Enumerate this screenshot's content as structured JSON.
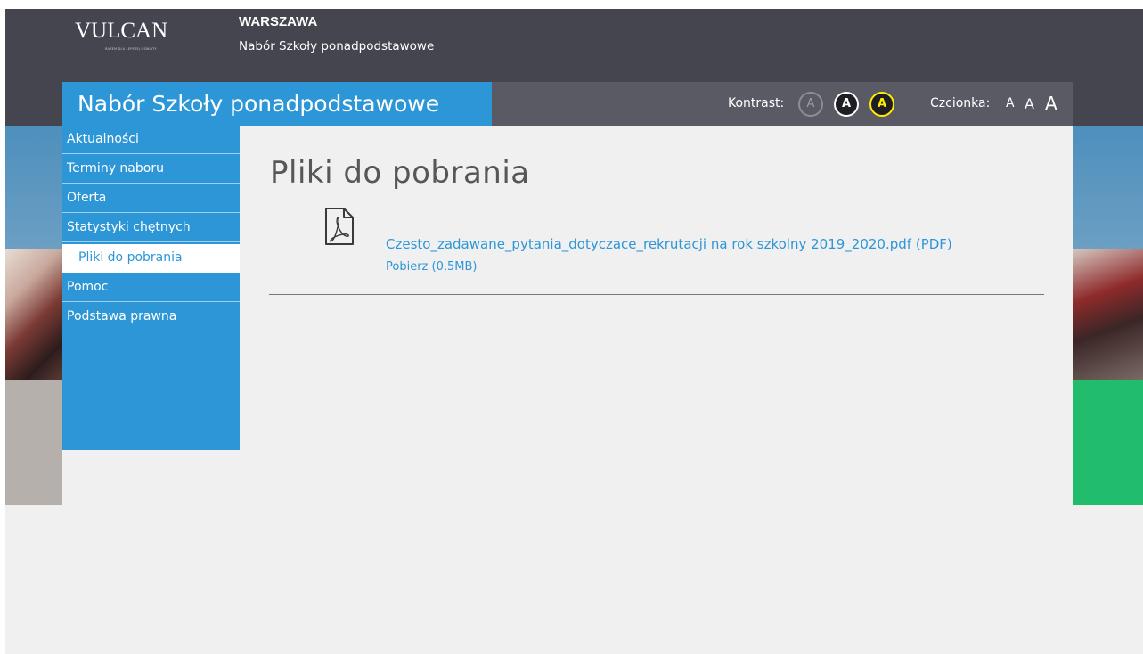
{
  "header": {
    "logo_text": "VULCAN",
    "logo_tagline": "RAZEM DLA LEPSZEJ OŚWIATY",
    "city": "WARSZAWA",
    "subtitle": "Nabór Szkoły ponadpodstawowe"
  },
  "titlebar": {
    "title": "Nabór Szkoły ponadpodstawowe",
    "contrast_label": "Kontrast:",
    "contrast_options": [
      "A",
      "A",
      "A"
    ],
    "font_label": "Czcionka:",
    "font_options": [
      "A",
      "A",
      "A"
    ]
  },
  "nav": {
    "items": [
      {
        "label": "Aktualności"
      },
      {
        "label": "Terminy naboru"
      },
      {
        "label": "Oferta"
      },
      {
        "label": "Statystyki chętnych"
      },
      {
        "label": "Pliki do pobrania",
        "active": true
      },
      {
        "label": "Pomoc"
      },
      {
        "label": "Podstawa prawna"
      }
    ]
  },
  "main": {
    "page_title": "Pliki do pobrania",
    "files": [
      {
        "name": "Czesto_zadawane_pytania_dotyczace_rekrutacji na rok szkolny 2019_2020.pdf (PDF)",
        "download_label": "Pobierz (0,5MB)",
        "icon": "pdf-file-icon"
      }
    ]
  },
  "colors": {
    "brand_blue": "#2d96d7",
    "topbar": "#45454f",
    "titlebar_gray": "#5a5a64",
    "contrast_yellow": "#ffed00",
    "green_accent": "#22bd6c"
  }
}
